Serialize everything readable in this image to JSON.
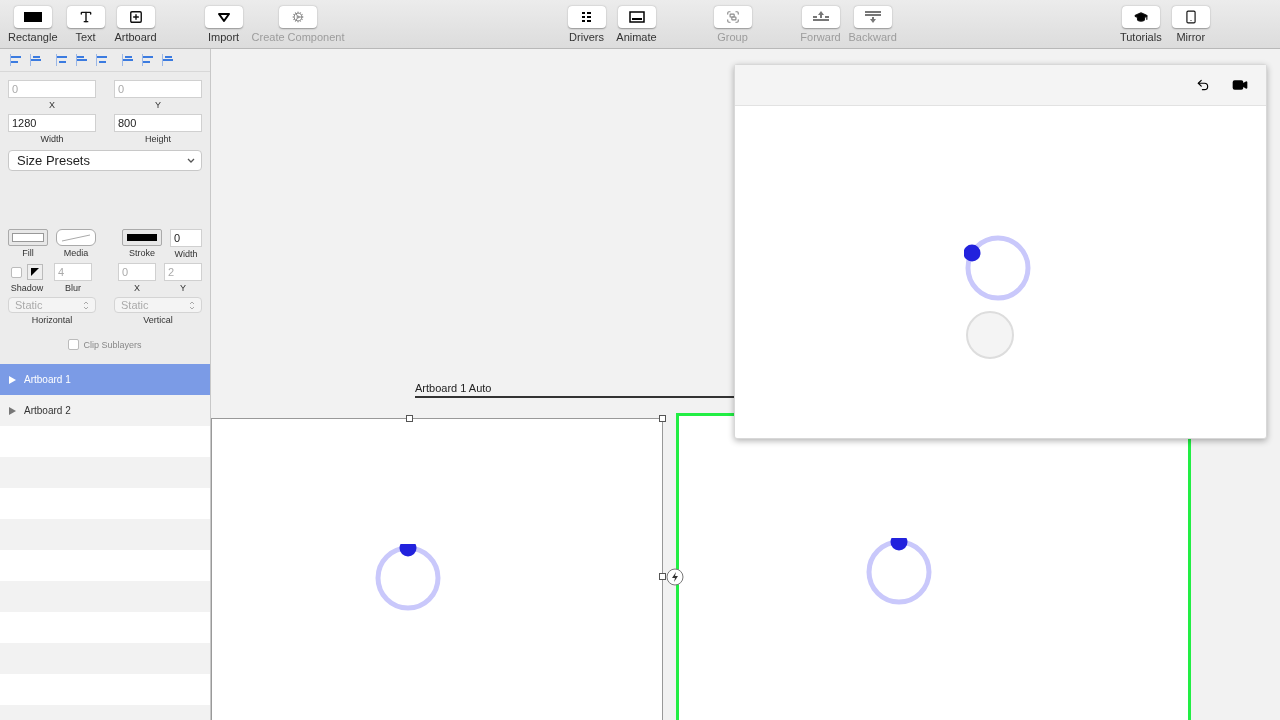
{
  "toolbar": {
    "groups": [
      {
        "items": [
          {
            "label": "Rectangle",
            "kind": "rectangle",
            "disabled": false
          },
          {
            "label": "Text",
            "kind": "text",
            "disabled": false
          },
          {
            "label": "Artboard",
            "kind": "artboard",
            "disabled": false
          }
        ]
      },
      {
        "items": [
          {
            "label": "Import",
            "kind": "import",
            "disabled": false
          },
          {
            "label": "Create Component",
            "kind": "component",
            "disabled": true
          }
        ]
      },
      {
        "items": [
          {
            "label": "Drivers",
            "kind": "drivers",
            "disabled": false
          },
          {
            "label": "Animate",
            "kind": "animate",
            "disabled": false
          }
        ]
      },
      {
        "items": [
          {
            "label": "Group",
            "kind": "group",
            "disabled": true
          }
        ]
      },
      {
        "items": [
          {
            "label": "Forward",
            "kind": "forward",
            "disabled": true
          },
          {
            "label": "Backward",
            "kind": "backward",
            "disabled": true
          }
        ]
      },
      {
        "items": [
          {
            "label": "Tutorials",
            "kind": "tutorials",
            "disabled": false
          },
          {
            "label": "Mirror",
            "kind": "mirror",
            "disabled": false
          }
        ]
      }
    ]
  },
  "inspector": {
    "position": [
      {
        "label": "X",
        "value": "0",
        "disabled": true
      },
      {
        "label": "Y",
        "value": "0",
        "disabled": true
      }
    ],
    "size": [
      {
        "label": "Width",
        "value": "1280",
        "disabled": false
      },
      {
        "label": "Height",
        "value": "800",
        "disabled": false
      }
    ],
    "size_presets": "Size Presets",
    "fill_label": "Fill",
    "media_label": "Media",
    "stroke_label": "Stroke",
    "stroke_width": {
      "label": "Width",
      "value": "0"
    },
    "shadow": {
      "label": "Shadow",
      "checked": false,
      "fields": [
        {
          "label": "Blur",
          "value": "4"
        },
        {
          "label": "X",
          "value": "0"
        },
        {
          "label": "Y",
          "value": "2"
        }
      ]
    },
    "constraints": [
      {
        "label": "Horizontal",
        "value": "Static"
      },
      {
        "label": "Vertical",
        "value": "Static"
      }
    ],
    "clip_sublayers": {
      "label": "Clip Sublayers",
      "checked": false
    }
  },
  "layers": [
    {
      "name": "Artboard 1",
      "selected": true
    },
    {
      "name": "Artboard 2",
      "selected": false
    }
  ],
  "canvas": {
    "auto_label": "Artboard 1 Auto",
    "artboards": [
      {
        "selected": true,
        "highlighted": false
      },
      {
        "selected": false,
        "highlighted": true
      }
    ]
  }
}
